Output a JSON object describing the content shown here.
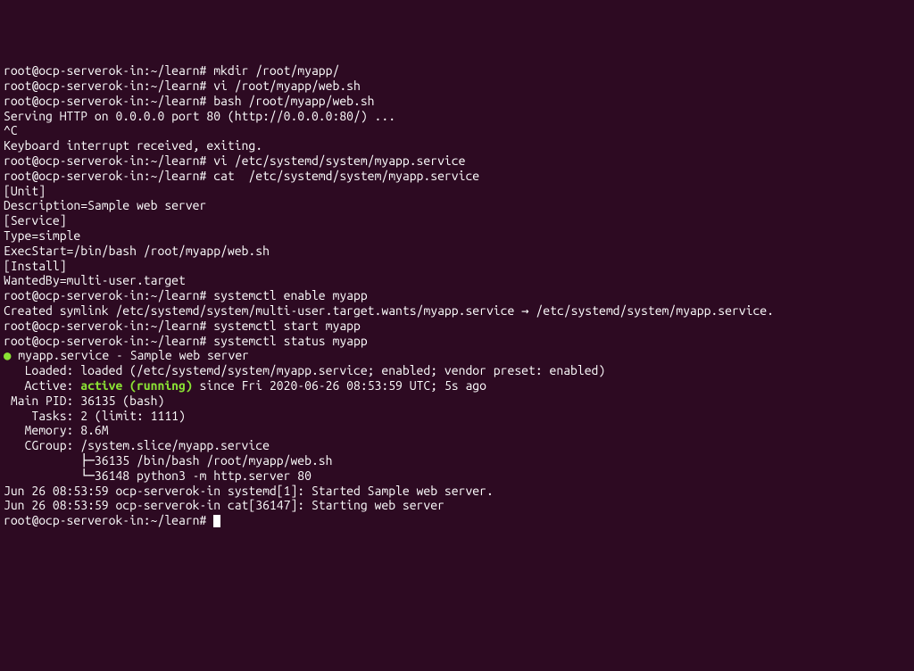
{
  "prompt": "root@ocp-serverok-in:~/learn#",
  "lines": {
    "l1_cmd": "mkdir /root/myapp/",
    "l2_cmd": "vi /root/myapp/web.sh",
    "l3_cmd": "bash /root/myapp/web.sh",
    "l4": "Serving HTTP on 0.0.0.0 port 80 (http://0.0.0.0:80/) ...",
    "l5": "^C",
    "l6": "Keyboard interrupt received, exiting.",
    "l7_cmd": "vi /etc/systemd/system/myapp.service",
    "l8_cmd": "cat  /etc/systemd/system/myapp.service",
    "l9": "[Unit]",
    "l10": "Description=Sample web server",
    "l11": "",
    "l12": "[Service]",
    "l13": "Type=simple",
    "l14": "ExecStart=/bin/bash /root/myapp/web.sh",
    "l15": "",
    "l16": "[Install]",
    "l17": "WantedBy=multi-user.target",
    "l18_cmd": "systemctl enable myapp",
    "l19": "Created symlink /etc/systemd/system/multi-user.target.wants/myapp.service → /etc/systemd/system/myapp.service.",
    "l20_cmd": "systemctl start myapp",
    "l21_cmd": "systemctl status myapp",
    "l22_service": "myapp.service - Sample web server",
    "l23": "   Loaded: loaded (/etc/systemd/system/myapp.service; enabled; vendor preset: enabled)",
    "l24_pre": "   Active: ",
    "l24_active": "active (running)",
    "l24_post": " since Fri 2020-06-26 08:53:59 UTC; 5s ago",
    "l25": " Main PID: 36135 (bash)",
    "l26": "    Tasks: 2 (limit: 1111)",
    "l27": "   Memory: 8.6M",
    "l28": "   CGroup: /system.slice/myapp.service",
    "l29": "           ├─36135 /bin/bash /root/myapp/web.sh",
    "l30": "           └─36148 python3 -m http.server 80",
    "l31": "",
    "l32": "Jun 26 08:53:59 ocp-serverok-in systemd[1]: Started Sample web server.",
    "l33": "Jun 26 08:53:59 ocp-serverok-in cat[36147]: Starting web server",
    "status_dot": "●"
  }
}
